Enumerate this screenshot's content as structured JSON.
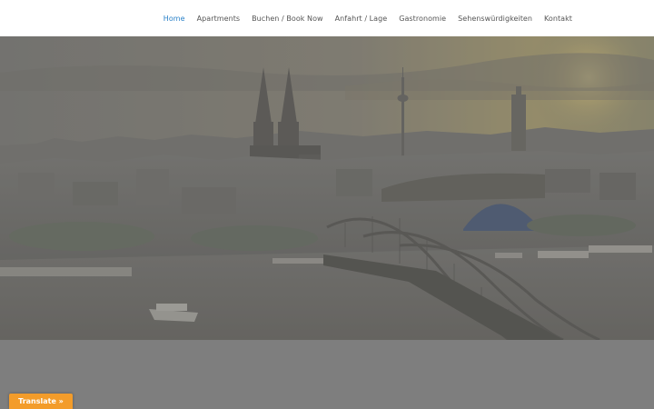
{
  "nav": {
    "items": [
      {
        "label": "Home",
        "active": true
      },
      {
        "label": "Apartments"
      },
      {
        "label": "Buchen / Book Now"
      },
      {
        "label": "Anfahrt / Lage"
      },
      {
        "label": "Gastronomie"
      },
      {
        "label": "Sehenswürdigkeiten"
      },
      {
        "label": "Kontakt"
      }
    ]
  },
  "hero": {
    "image": "cologne-skyline-cathedral-hohenzollern-bridge-sunset"
  },
  "translate": {
    "label": "Translate »"
  },
  "colors": {
    "nav_active": "#2b82c9",
    "nav_text": "#555555",
    "band": "#7e7e7e",
    "translate_button": "#f39c2a"
  }
}
